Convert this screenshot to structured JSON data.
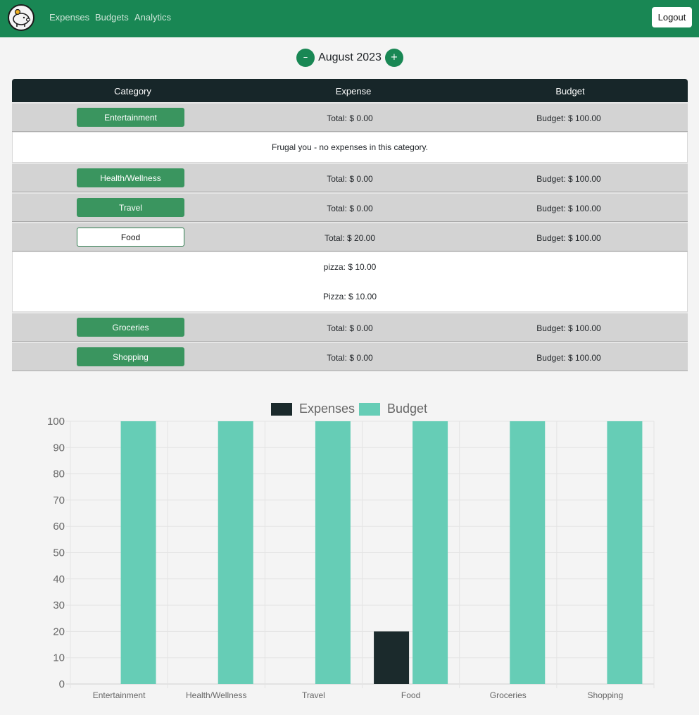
{
  "nav": {
    "links": [
      "Expenses",
      "Budgets",
      "Analytics"
    ],
    "logout": "Logout",
    "brand_color": "#198754"
  },
  "month": {
    "prev": "–",
    "label": "August 2023",
    "next": "+"
  },
  "table": {
    "headers": [
      "Category",
      "Expense",
      "Budget"
    ],
    "rows": [
      {
        "category": "Entertainment",
        "expense": "Total: $ 0.00",
        "budget": "Budget: $ 100.00",
        "details": [
          "Frugal you - no expenses in this category."
        ]
      },
      {
        "category": "Health/Wellness",
        "expense": "Total: $ 0.00",
        "budget": "Budget: $ 100.00"
      },
      {
        "category": "Travel",
        "expense": "Total: $ 0.00",
        "budget": "Budget: $ 100.00"
      },
      {
        "category": "Food",
        "expense": "Total: $ 20.00",
        "budget": "Budget: $ 100.00",
        "details": [
          "pizza: $ 10.00",
          "Pizza: $ 10.00"
        ]
      },
      {
        "category": "Groceries",
        "expense": "Total: $ 0.00",
        "budget": "Budget: $ 100.00"
      },
      {
        "category": "Shopping",
        "expense": "Total: $ 0.00",
        "budget": "Budget: $ 100.00"
      }
    ]
  },
  "chart_data": {
    "type": "bar",
    "categories": [
      "Entertainment",
      "Health/Wellness",
      "Travel",
      "Food",
      "Groceries",
      "Shopping"
    ],
    "series": [
      {
        "name": "Expenses",
        "values": [
          0,
          0,
          0,
          20,
          0,
          0
        ],
        "color": "#1b2a2c"
      },
      {
        "name": "Budget",
        "values": [
          100,
          100,
          100,
          100,
          100,
          100
        ],
        "color": "#66cdb6"
      }
    ],
    "ylim": [
      0,
      100
    ],
    "yticks": [
      0,
      10,
      20,
      30,
      40,
      50,
      60,
      70,
      80,
      90,
      100
    ],
    "legend": "top",
    "grid": true
  }
}
